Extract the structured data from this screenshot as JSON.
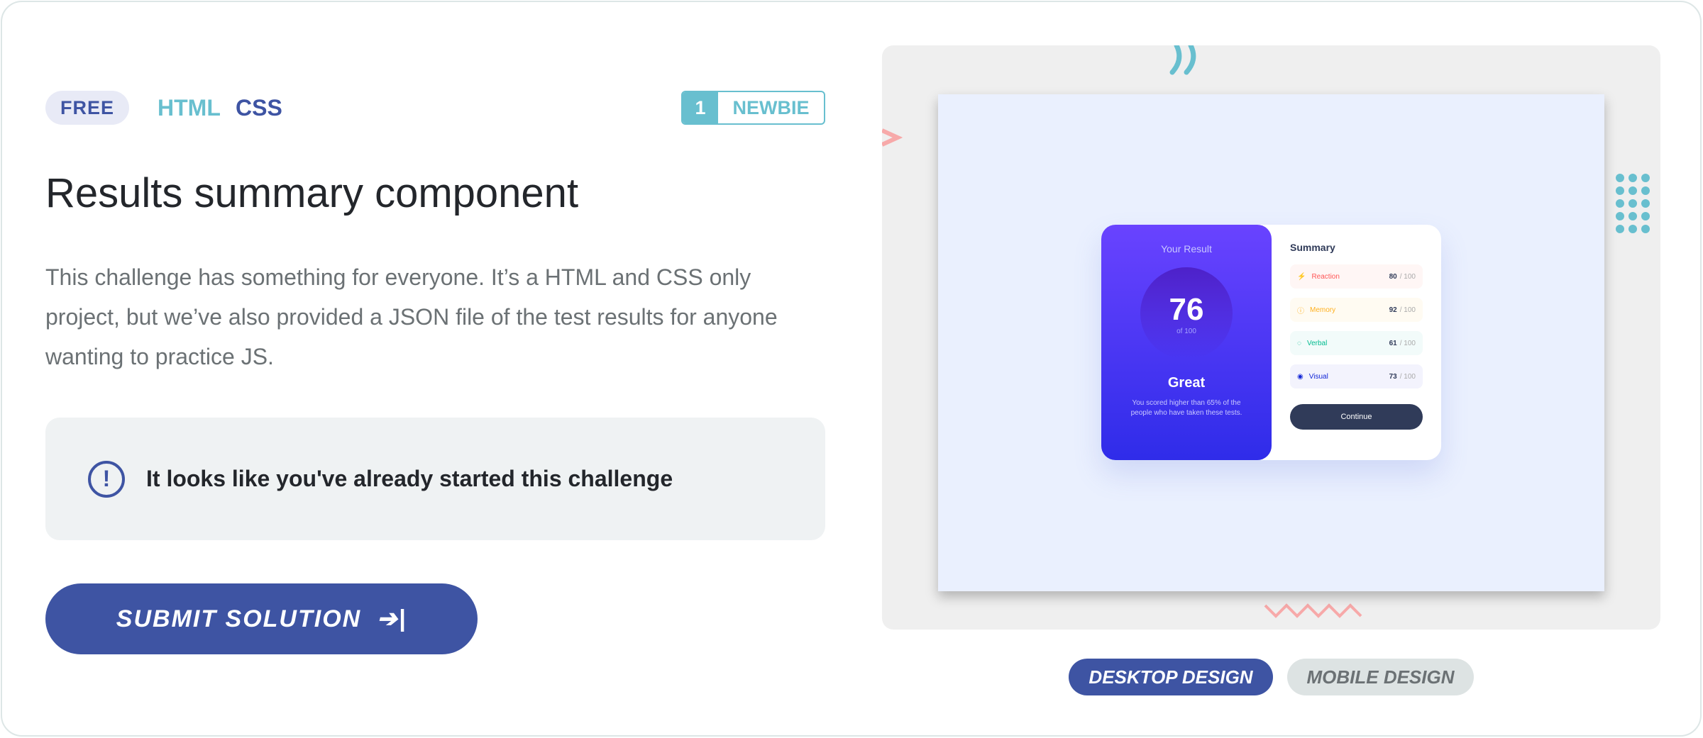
{
  "tags": {
    "price": "FREE",
    "languages": [
      "HTML",
      "CSS"
    ]
  },
  "difficulty": {
    "level": "1",
    "label": "NEWBIE"
  },
  "title": "Results summary component",
  "description": "This challenge has something for everyone. It’s a HTML and CSS only project, but we’ve also provided a JSON file of the test results for anyone wanting to practice JS.",
  "notice": "It looks like you've already started this challenge",
  "submit_label": "SUBMIT SOLUTION",
  "preview": {
    "result_heading": "Your Result",
    "score": "76",
    "of": "of 100",
    "rating": "Great",
    "summary_text": "You scored higher than 65% of the people who have taken these tests.",
    "summary_heading": "Summary",
    "items": [
      {
        "name": "Reaction",
        "score": "80",
        "max": "/ 100",
        "color": "#ff5757",
        "bg": "#fff6f5",
        "icon": "⚡"
      },
      {
        "name": "Memory",
        "score": "92",
        "max": "/ 100",
        "color": "#ffb01f",
        "bg": "#fffbf2",
        "icon": "ⓘ"
      },
      {
        "name": "Verbal",
        "score": "61",
        "max": "/ 100",
        "color": "#00bb8f",
        "bg": "#f2fbfa",
        "icon": "◌"
      },
      {
        "name": "Visual",
        "score": "73",
        "max": "/ 100",
        "color": "#1125d6",
        "bg": "#f3f3fd",
        "icon": "◉"
      }
    ],
    "continue_label": "Continue"
  },
  "design_tabs": {
    "desktop": "DESKTOP DESIGN",
    "mobile": "MOBILE DESIGN"
  },
  "colors": {
    "primary": "#3e54a3",
    "teal": "#68bfcf"
  }
}
